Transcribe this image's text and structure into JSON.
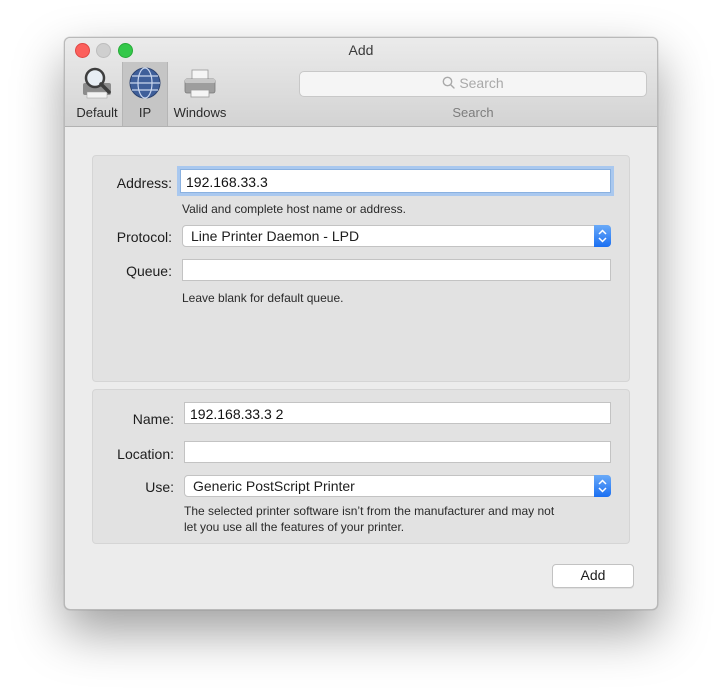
{
  "window": {
    "title": "Add"
  },
  "toolbar": {
    "tabs": [
      {
        "label": "Default",
        "icon": "magnifier-printer-icon"
      },
      {
        "label": "IP",
        "icon": "globe-icon"
      },
      {
        "label": "Windows",
        "icon": "printer-icon"
      }
    ],
    "selected_tab": "IP",
    "search": {
      "placeholder": "Search",
      "caption": "Search"
    }
  },
  "ip_panel": {
    "address_label": "Address:",
    "address_value": "192.168.33.3",
    "address_hint": "Valid and complete host name or address.",
    "protocol_label": "Protocol:",
    "protocol_value": "Line Printer Daemon - LPD",
    "queue_label": "Queue:",
    "queue_value": "",
    "queue_hint": "Leave blank for default queue."
  },
  "printer_panel": {
    "name_label": "Name:",
    "name_value": "192.168.33.3 2",
    "location_label": "Location:",
    "location_value": "",
    "use_label": "Use:",
    "use_value": "Generic PostScript Printer",
    "use_warning_line1": "The selected printer software isn’t from the manufacturer and may not",
    "use_warning_line2": "let you use all the features of your printer."
  },
  "footer": {
    "add_button": "Add"
  },
  "colors": {
    "accent": "#1a6ff2",
    "focus_ring": "#a9c8ef",
    "close": "#fc605c",
    "zoom": "#34c84a"
  }
}
